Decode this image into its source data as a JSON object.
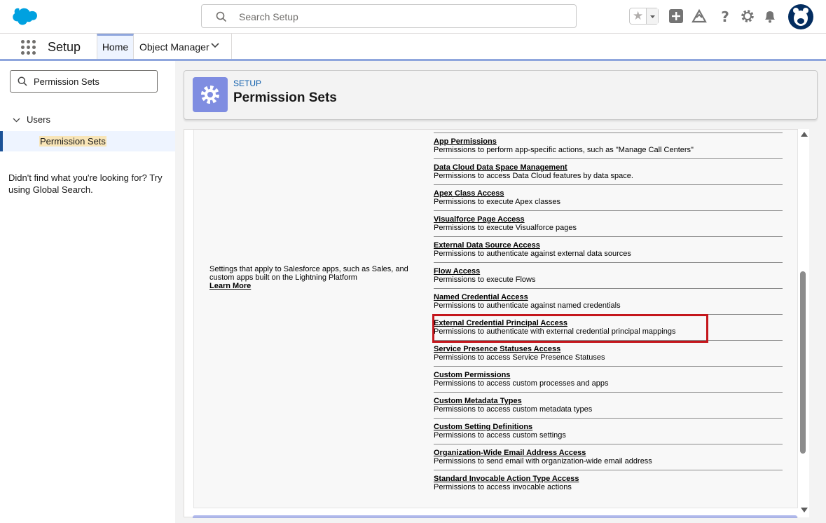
{
  "header": {
    "search_placeholder": "Search Setup",
    "icons": [
      "salesforce-cloud-logo",
      "search-icon",
      "favorites-star-icon",
      "add-icon",
      "trailhead-icon",
      "help-icon",
      "setup-gear-icon",
      "notifications-bell-icon",
      "user-avatar"
    ]
  },
  "nav": {
    "app_name": "Setup",
    "tabs": [
      {
        "label": "Home"
      },
      {
        "label": "Object Manager"
      }
    ]
  },
  "sidebar": {
    "quick_find_value": "Permission Sets",
    "tree": {
      "parent": "Users",
      "selected_child": "Permission Sets"
    },
    "not_found_text": "Didn't find what you're looking for? Try using Global Search."
  },
  "page_header": {
    "eyebrow": "SETUP",
    "title": "Permission Sets"
  },
  "content": {
    "description": "Settings that apply to Salesforce apps, such as Sales, and custom apps built on the Lightning Platform",
    "learn_more": "Learn More",
    "items": [
      {
        "title": "App Permissions",
        "desc": "Permissions to perform app-specific actions, such as \"Manage Call Centers\""
      },
      {
        "title": "Data Cloud Data Space Management",
        "desc": "Permissions to access Data Cloud features by data space."
      },
      {
        "title": "Apex Class Access",
        "desc": "Permissions to execute Apex classes"
      },
      {
        "title": "Visualforce Page Access",
        "desc": "Permissions to execute Visualforce pages"
      },
      {
        "title": "External Data Source Access",
        "desc": "Permissions to authenticate against external data sources"
      },
      {
        "title": "Flow Access",
        "desc": "Permissions to execute Flows"
      },
      {
        "title": "Named Credential Access",
        "desc": "Permissions to authenticate against named credentials"
      },
      {
        "title": "External Credential Principal Access",
        "desc": "Permissions to authenticate with external credential principal mappings"
      },
      {
        "title": "Service Presence Statuses Access",
        "desc": "Permissions to access Service Presence Statuses"
      },
      {
        "title": "Custom Permissions",
        "desc": "Permissions to access custom processes and apps"
      },
      {
        "title": "Custom Metadata Types",
        "desc": "Permissions to access custom metadata types"
      },
      {
        "title": "Custom Setting Definitions",
        "desc": "Permissions to access custom settings"
      },
      {
        "title": "Organization-Wide Email Address Access",
        "desc": "Permissions to send email with organization-wide email address"
      },
      {
        "title": "Standard Invocable Action Type Access",
        "desc": "Permissions to access invocable actions"
      }
    ]
  },
  "colors": {
    "brand": "#00a1e0",
    "nav_accent": "#8fa6dd",
    "highlight_box": "#c4161c",
    "setup_icon_bg": "#7f8de1"
  }
}
